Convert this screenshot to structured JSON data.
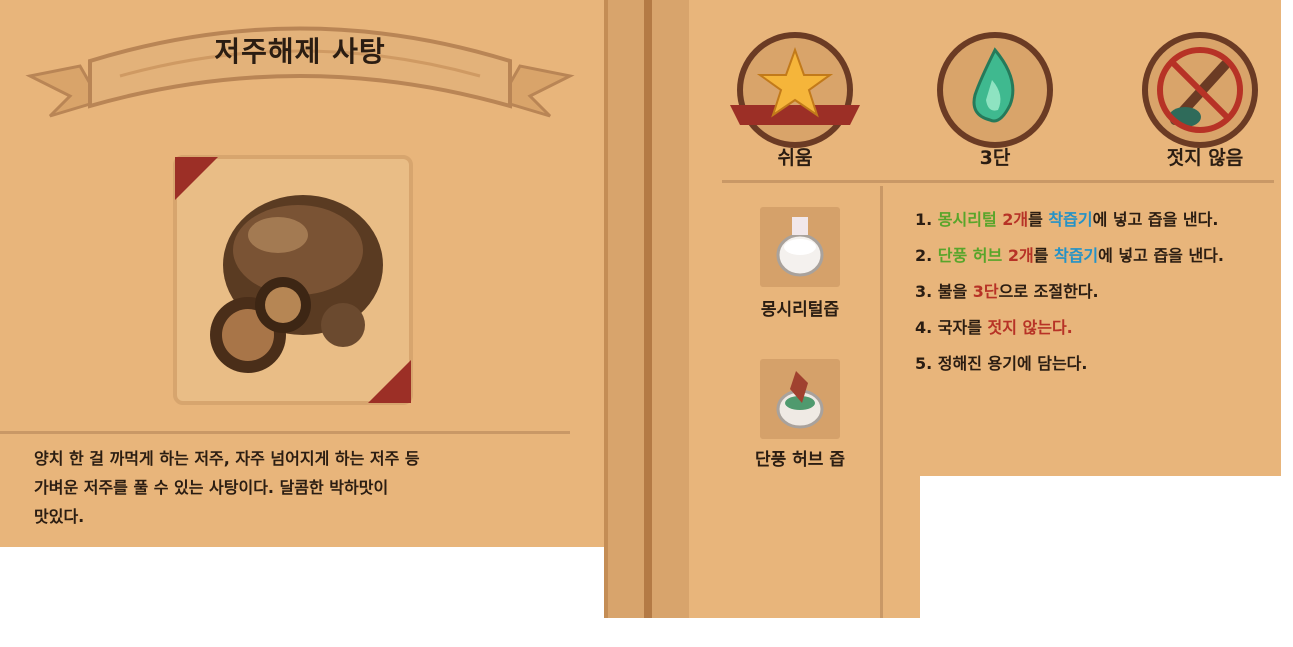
{
  "recipe": {
    "title": "저주해제 사탕",
    "description_lines": [
      "양치 한 걸 까먹게 하는 저주, 자주 넘어지게 하는 저주 등",
      "가벼운 저주를 풀 수 있는 사탕이다. 달콤한 박하맛이",
      "맛있다."
    ]
  },
  "badges": [
    {
      "icon": "star-ribbon-icon",
      "label": "쉬움"
    },
    {
      "icon": "green-flame-icon",
      "label": "3단",
      "level": "3"
    },
    {
      "icon": "no-stir-icon",
      "label": "젓지 않음"
    }
  ],
  "ingredients": [
    {
      "icon": "mongsiri-juice-icon",
      "label": "몽시리털즙"
    },
    {
      "icon": "maple-herb-juice-icon",
      "label": "단풍 허브 즙"
    }
  ],
  "steps": [
    {
      "num": "1.",
      "parts": [
        {
          "text": "몽시리털",
          "style": "g"
        },
        {
          "text": " ",
          "style": ""
        },
        {
          "text": "2개",
          "style": "r"
        },
        {
          "text": "를 ",
          "style": ""
        },
        {
          "text": "착즙기",
          "style": "b"
        },
        {
          "text": "에 넣고 즙을 낸다.",
          "style": ""
        }
      ]
    },
    {
      "num": "2.",
      "parts": [
        {
          "text": "단풍 허브",
          "style": "g"
        },
        {
          "text": " ",
          "style": ""
        },
        {
          "text": "2개",
          "style": "r"
        },
        {
          "text": "를 ",
          "style": ""
        },
        {
          "text": "착즙기",
          "style": "b"
        },
        {
          "text": "에 넣고 즙을 낸다.",
          "style": ""
        }
      ]
    },
    {
      "num": "3.",
      "parts": [
        {
          "text": "불을 ",
          "style": ""
        },
        {
          "text": "3단",
          "style": "r"
        },
        {
          "text": "으로 조절한다.",
          "style": ""
        }
      ]
    },
    {
      "num": "4.",
      "parts": [
        {
          "text": "국자를 ",
          "style": ""
        },
        {
          "text": "젓지 않는다.",
          "style": "r"
        }
      ]
    },
    {
      "num": "5.",
      "parts": [
        {
          "text": "정해진 용기에 담는다.",
          "style": ""
        }
      ]
    }
  ],
  "colors": {
    "page": "#e8b57b",
    "highlight_green": "#58a52a",
    "highlight_red": "#b73226",
    "highlight_blue": "#2492c7"
  }
}
